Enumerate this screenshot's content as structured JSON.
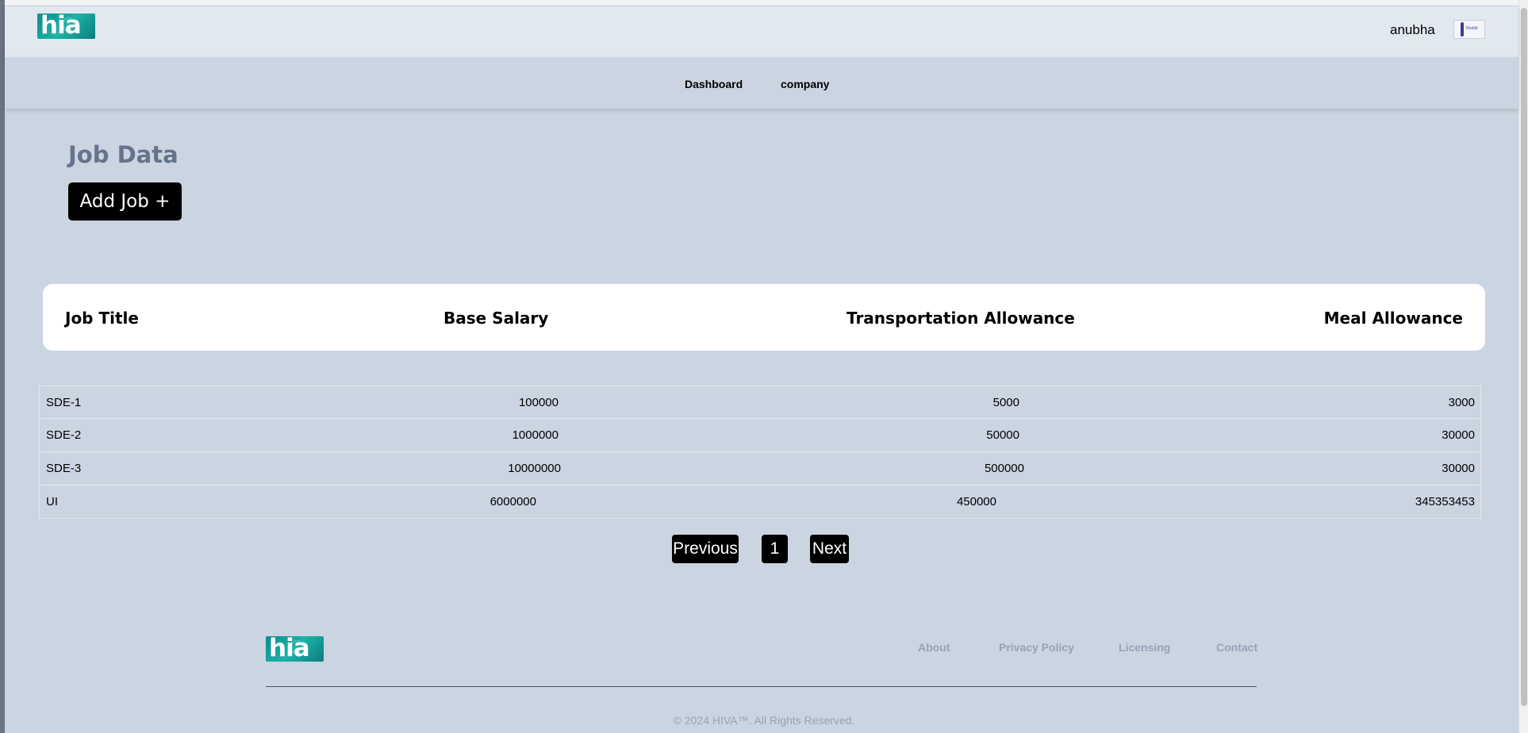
{
  "header": {
    "logo_text": "hia",
    "username": "anubha",
    "avatar_label": "Reddit"
  },
  "nav": {
    "items": [
      {
        "label": "Dashboard"
      },
      {
        "label": "company"
      }
    ]
  },
  "main": {
    "title": "Job Data",
    "add_button": "Add Job +",
    "table": {
      "headers": [
        "Job Title",
        "Base Salary",
        "Transportation Allowance",
        "Meal Allowance"
      ],
      "rows": [
        [
          "SDE-1",
          "100000",
          "5000",
          "3000"
        ],
        [
          "SDE-2",
          "1000000",
          "50000",
          "30000"
        ],
        [
          "SDE-3",
          "10000000",
          "500000",
          "30000"
        ],
        [
          "UI",
          "6000000",
          "450000",
          "345353453"
        ]
      ]
    },
    "pagination": {
      "previous": "Previous",
      "page": "1",
      "next": "Next"
    }
  },
  "footer": {
    "logo_text": "hia",
    "links": [
      "About",
      "Privacy Policy",
      "Licensing",
      "Contact"
    ],
    "copyright": "© 2024 HIVA™. All Rights Reserved."
  },
  "colors": {
    "background": "#cbd5e1",
    "header": "#e2e8f0",
    "button": "#000000",
    "title": "#64748b",
    "footer_text": "#94a3b8",
    "logo": "#1bb3a7"
  }
}
